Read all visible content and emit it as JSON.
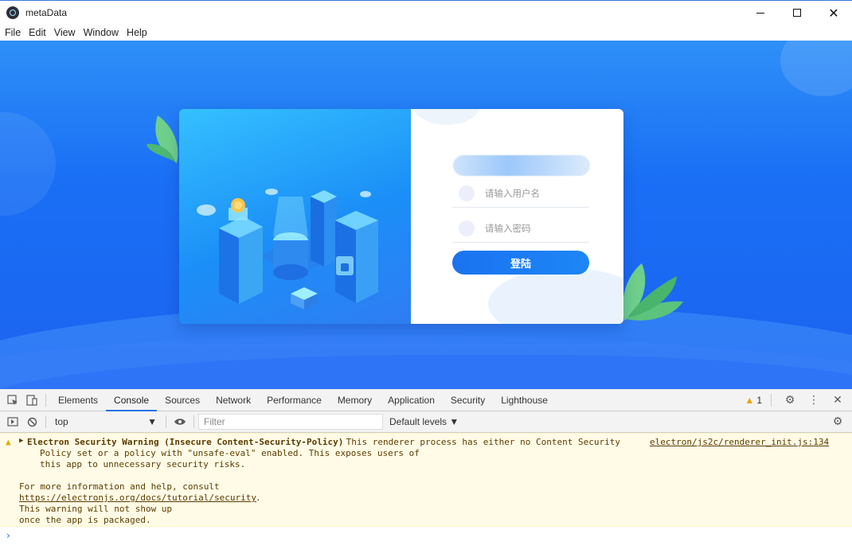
{
  "window": {
    "title": "metaData",
    "controls": {
      "minimize": "minimize",
      "maximize": "maximize",
      "close": "✕"
    }
  },
  "menubar": {
    "items": [
      "File",
      "Edit",
      "View",
      "Window",
      "Help"
    ]
  },
  "login": {
    "username_placeholder": "请输入用户名",
    "password_placeholder": "请输入密码",
    "submit_label": "登陆"
  },
  "devtools": {
    "tabs": [
      "Elements",
      "Console",
      "Sources",
      "Network",
      "Performance",
      "Memory",
      "Application",
      "Security",
      "Lighthouse"
    ],
    "active_tab": "Console",
    "warning_count": "1",
    "context": "top",
    "filter_placeholder": "Filter",
    "levels": "Default levels ▼",
    "message": {
      "title": "Electron Security Warning (Insecure Content-Security-Policy)",
      "text1": " This renderer process has either no Content Security",
      "text2": "Policy set or a policy with \"unsafe-eval\" enabled. This exposes users of",
      "text3": "this app to unnecessary security risks.",
      "source": "electron/js2c/renderer_init.js:134",
      "more1": "For more information and help, consult",
      "link": "https://electronjs.org/docs/tutorial/security",
      "link_tail": ".",
      "more2": "This warning will not show up",
      "more3": "once the app is packaged."
    },
    "prompt": "›"
  },
  "colors": {
    "accent": "#1a73f0",
    "warning_bg": "#fffbe6",
    "devtools_tab_active": "#1a73e8"
  }
}
